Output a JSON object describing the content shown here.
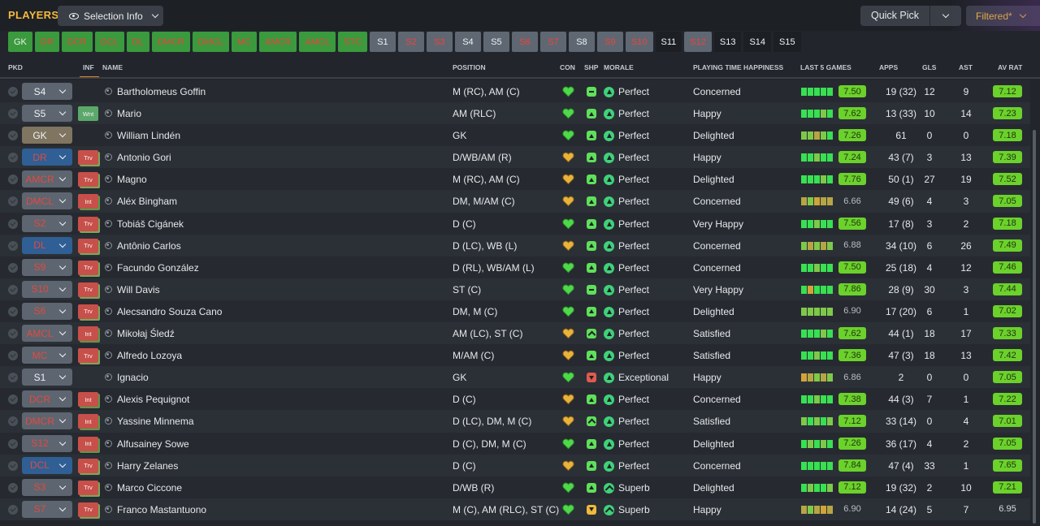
{
  "topbar": {
    "title": "PLAYERS",
    "selection_info": "Selection Info",
    "quick_pick": "Quick Pick",
    "filtered": "Filtered*"
  },
  "chips": [
    {
      "label": "GK",
      "style": "green"
    },
    {
      "label": "DR",
      "style": "green red-t"
    },
    {
      "label": "DCR",
      "style": "green red-t"
    },
    {
      "label": "DCL",
      "style": "green red-t"
    },
    {
      "label": "DL",
      "style": "green red-t"
    },
    {
      "label": "DMCR",
      "style": "green red-t"
    },
    {
      "label": "DMCL",
      "style": "green red-t"
    },
    {
      "label": "MC",
      "style": "green red-t"
    },
    {
      "label": "AMCR",
      "style": "green red-t"
    },
    {
      "label": "AMCL",
      "style": "green red-t"
    },
    {
      "label": "STC",
      "style": "green red-t"
    },
    {
      "label": "S1",
      "style": "grey"
    },
    {
      "label": "S2",
      "style": "grey red-t"
    },
    {
      "label": "S3",
      "style": "grey red-t"
    },
    {
      "label": "S4",
      "style": "grey"
    },
    {
      "label": "S5",
      "style": "grey"
    },
    {
      "label": "S6",
      "style": "grey red-t"
    },
    {
      "label": "S7",
      "style": "grey red-t"
    },
    {
      "label": "S8",
      "style": "grey"
    },
    {
      "label": "S9",
      "style": "grey red-t"
    },
    {
      "label": "S10",
      "style": "grey red-t"
    },
    {
      "label": "S11",
      "style": "dark"
    },
    {
      "label": "S12",
      "style": "grey red-t"
    },
    {
      "label": "S13",
      "style": "dark"
    },
    {
      "label": "S14",
      "style": "dark"
    },
    {
      "label": "S15",
      "style": "dark"
    }
  ],
  "columns": {
    "pkd": "PKD",
    "inf": "INF",
    "name": "NAME",
    "position": "POSITION",
    "con": "CON",
    "shp": "SHP",
    "morale": "MORALE",
    "pth": "PLAYING TIME HAPPINESS",
    "last5": "LAST 5 GAMES",
    "apps": "APPS",
    "gls": "GLS",
    "ast": "AST",
    "avrat": "AV RAT"
  },
  "colors": {
    "accent": "#f5b93d",
    "rating_green": "#6bd12b",
    "chip_green": "#3a9a3d"
  },
  "rows": [
    {
      "pos": "S4",
      "posStyle": "grey",
      "inf": "",
      "name": "Bartholomeus Goffin",
      "position": "M (RC), AM (C)",
      "con": "green",
      "shp": "flat",
      "shpColor": "shp-green",
      "morale": "Perfect",
      "moraleIcon": "up",
      "pth": "Concerned",
      "last5": [
        "g",
        "g",
        "g",
        "g",
        "g"
      ],
      "rating": "7.50",
      "ratingHi": true,
      "apps": "19 (32)",
      "gls": "12",
      "ast": "9",
      "avrat": "7.12",
      "avHi": true
    },
    {
      "pos": "S5",
      "posStyle": "grey",
      "inf": "Wnt",
      "name": "Mario",
      "position": "AM (RLC)",
      "con": "green",
      "shp": "up",
      "shpColor": "shp-green",
      "morale": "Perfect",
      "moraleIcon": "up",
      "pth": "Happy",
      "last5": [
        "g",
        "g",
        "g",
        "lg",
        "g"
      ],
      "rating": "7.62",
      "ratingHi": true,
      "apps": "13 (33)",
      "gls": "10",
      "ast": "14",
      "avrat": "7.23",
      "avHi": true
    },
    {
      "pos": "GK",
      "posStyle": "gk",
      "inf": "",
      "name": "William Lindén",
      "position": "GK",
      "con": "green",
      "shp": "up",
      "shpColor": "shp-green",
      "morale": "Perfect",
      "moraleIcon": "up",
      "pth": "Delighted",
      "last5": [
        "lg",
        "lg",
        "y",
        "lg",
        "g"
      ],
      "rating": "7.26",
      "ratingHi": true,
      "apps": "61",
      "gls": "0",
      "ast": "0",
      "avrat": "7.18",
      "avHi": true
    },
    {
      "pos": "DR",
      "posStyle": "blue",
      "inf": "Trv",
      "name": "Antonio Gori",
      "position": "D/WB/AM (R)",
      "con": "yellow",
      "shp": "up",
      "shpColor": "shp-green",
      "morale": "Perfect",
      "moraleIcon": "up",
      "pth": "Happy",
      "last5": [
        "g",
        "g",
        "lg",
        "g",
        "g"
      ],
      "rating": "7.24",
      "ratingHi": true,
      "apps": "43 (7)",
      "gls": "3",
      "ast": "13",
      "avrat": "7.39",
      "avHi": true
    },
    {
      "pos": "AMCR",
      "posStyle": "grey-red",
      "inf": "Trv",
      "name": "Magno",
      "position": "M (RC), AM (C)",
      "con": "yellow",
      "shp": "up",
      "shpColor": "shp-green",
      "morale": "Perfect",
      "moraleIcon": "up",
      "pth": "Delighted",
      "last5": [
        "g",
        "g",
        "g",
        "lg",
        "g"
      ],
      "rating": "7.76",
      "ratingHi": true,
      "apps": "50 (1)",
      "gls": "27",
      "ast": "19",
      "avrat": "7.52",
      "avHi": true
    },
    {
      "pos": "DMCL",
      "posStyle": "grey-red",
      "inf": "Int",
      "name": "Aléx Bingham",
      "position": "DM, M/AM (C)",
      "con": "yellow",
      "shp": "up",
      "shpColor": "shp-green",
      "morale": "Perfect",
      "moraleIcon": "up",
      "pth": "Concerned",
      "last5": [
        "y",
        "lg",
        "o",
        "y",
        "y"
      ],
      "rating": "6.66",
      "ratingHi": false,
      "apps": "49 (6)",
      "gls": "4",
      "ast": "3",
      "avrat": "7.05",
      "avHi": true
    },
    {
      "pos": "S2",
      "posStyle": "grey-red",
      "inf": "Trv",
      "name": "Tobiáš Cigánek",
      "position": "D (C)",
      "con": "green",
      "shp": "up",
      "shpColor": "shp-green",
      "morale": "Perfect",
      "moraleIcon": "up",
      "pth": "Very Happy",
      "last5": [
        "g",
        "g",
        "lg",
        "g",
        "g"
      ],
      "rating": "7.56",
      "ratingHi": true,
      "apps": "17 (8)",
      "gls": "3",
      "ast": "2",
      "avrat": "7.18",
      "avHi": true
    },
    {
      "pos": "DL",
      "posStyle": "blue",
      "inf": "Trv",
      "name": "Antônio Carlos",
      "position": "D (LC), WB (L)",
      "con": "yellow",
      "shp": "up",
      "shpColor": "shp-green",
      "morale": "Perfect",
      "moraleIcon": "up",
      "pth": "Concerned",
      "last5": [
        "lg",
        "y",
        "lg",
        "y",
        "lg"
      ],
      "rating": "6.88",
      "ratingHi": false,
      "apps": "34 (10)",
      "gls": "6",
      "ast": "26",
      "avrat": "7.49",
      "avHi": true
    },
    {
      "pos": "S9",
      "posStyle": "grey-red",
      "inf": "Trv",
      "name": "Facundo González",
      "position": "D (RL), WB/AM (L)",
      "con": "green",
      "shp": "up",
      "shpColor": "shp-green",
      "morale": "Perfect",
      "moraleIcon": "up",
      "pth": "Concerned",
      "last5": [
        "g",
        "g",
        "lg",
        "g",
        "g"
      ],
      "rating": "7.50",
      "ratingHi": true,
      "apps": "25 (18)",
      "gls": "4",
      "ast": "12",
      "avrat": "7.46",
      "avHi": true
    },
    {
      "pos": "S10",
      "posStyle": "grey-red",
      "inf": "Trv",
      "name": "Will Davis",
      "position": "ST (C)",
      "con": "green",
      "shp": "flat",
      "shpColor": "shp-green",
      "morale": "Perfect",
      "moraleIcon": "up",
      "pth": "Very Happy",
      "last5": [
        "g",
        "o",
        "g",
        "g",
        "g"
      ],
      "rating": "7.86",
      "ratingHi": true,
      "apps": "28 (9)",
      "gls": "30",
      "ast": "3",
      "avrat": "7.44",
      "avHi": true
    },
    {
      "pos": "S6",
      "posStyle": "grey-red",
      "inf": "Trv",
      "name": "Alecsandro Souza Cano",
      "position": "DM, M (C)",
      "con": "green",
      "shp": "up",
      "shpColor": "shp-green",
      "morale": "Perfect",
      "moraleIcon": "up",
      "pth": "Delighted",
      "last5": [
        "lg",
        "lg",
        "lg",
        "lg",
        "lg"
      ],
      "rating": "6.90",
      "ratingHi": false,
      "apps": "17 (20)",
      "gls": "6",
      "ast": "1",
      "avrat": "7.02",
      "avHi": true
    },
    {
      "pos": "AMCL",
      "posStyle": "grey-red",
      "inf": "Int",
      "name": "Mikołaj Śledź",
      "position": "AM (LC), ST (C)",
      "con": "yellow",
      "shp": "up2",
      "shpColor": "shp-green",
      "morale": "Perfect",
      "moraleIcon": "up",
      "pth": "Satisfied",
      "last5": [
        "g",
        "g",
        "g",
        "lg",
        "g"
      ],
      "rating": "7.62",
      "ratingHi": true,
      "apps": "44 (1)",
      "gls": "18",
      "ast": "17",
      "avrat": "7.33",
      "avHi": true
    },
    {
      "pos": "MC",
      "posStyle": "grey-red",
      "inf": "Trv",
      "name": "Alfredo Lozoya",
      "position": "M/AM (C)",
      "con": "yellow",
      "shp": "up",
      "shpColor": "shp-green",
      "morale": "Perfect",
      "moraleIcon": "up",
      "pth": "Satisfied",
      "last5": [
        "g",
        "g",
        "lg",
        "g",
        "g"
      ],
      "rating": "7.36",
      "ratingHi": true,
      "apps": "47 (3)",
      "gls": "18",
      "ast": "13",
      "avrat": "7.42",
      "avHi": true
    },
    {
      "pos": "S1",
      "posStyle": "grey",
      "inf": "",
      "name": "Ignacio",
      "position": "GK",
      "con": "green",
      "shp": "down",
      "shpColor": "shp-red",
      "morale": "Exceptional",
      "moraleIcon": "up",
      "pth": "Happy",
      "last5": [
        "o",
        "y",
        "lg",
        "y",
        "lg"
      ],
      "rating": "6.86",
      "ratingHi": false,
      "apps": "2",
      "gls": "0",
      "ast": "0",
      "avrat": "7.05",
      "avHi": true
    },
    {
      "pos": "DCR",
      "posStyle": "grey-red",
      "inf": "Int",
      "name": "Alexis Pequignot",
      "position": "D (C)",
      "con": "yellow",
      "shp": "up",
      "shpColor": "shp-green",
      "morale": "Perfect",
      "moraleIcon": "up",
      "pth": "Concerned",
      "last5": [
        "g",
        "g",
        "lg",
        "g",
        "g"
      ],
      "rating": "7.38",
      "ratingHi": true,
      "apps": "44 (3)",
      "gls": "7",
      "ast": "1",
      "avrat": "7.22",
      "avHi": true
    },
    {
      "pos": "DMCR",
      "posStyle": "grey-red",
      "inf": "Int",
      "name": "Yassine Minnema",
      "position": "D (LC), DM, M (C)",
      "con": "yellow",
      "shp": "up2",
      "shpColor": "shp-green",
      "morale": "Perfect",
      "moraleIcon": "up",
      "pth": "Satisfied",
      "last5": [
        "lg",
        "g",
        "lg",
        "g",
        "lg"
      ],
      "rating": "7.12",
      "ratingHi": true,
      "apps": "33 (14)",
      "gls": "0",
      "ast": "4",
      "avrat": "7.01",
      "avHi": true
    },
    {
      "pos": "S12",
      "posStyle": "grey-red",
      "inf": "Int",
      "name": "Alfusainey Sowe",
      "position": "D (C), DM, M (C)",
      "con": "green",
      "shp": "up",
      "shpColor": "shp-green",
      "morale": "Perfect",
      "moraleIcon": "up",
      "pth": "Delighted",
      "last5": [
        "g",
        "lg",
        "g",
        "lg",
        "g"
      ],
      "rating": "7.26",
      "ratingHi": true,
      "apps": "36 (17)",
      "gls": "4",
      "ast": "2",
      "avrat": "7.05",
      "avHi": true
    },
    {
      "pos": "DCL",
      "posStyle": "blue",
      "inf": "Trv",
      "name": "Harry Zelanes",
      "position": "D (C)",
      "con": "yellow",
      "shp": "up",
      "shpColor": "shp-green",
      "morale": "Perfect",
      "moraleIcon": "up",
      "pth": "Concerned",
      "last5": [
        "g",
        "g",
        "g",
        "g",
        "g"
      ],
      "rating": "7.84",
      "ratingHi": true,
      "apps": "47 (4)",
      "gls": "33",
      "ast": "1",
      "avrat": "7.65",
      "avHi": true
    },
    {
      "pos": "S3",
      "posStyle": "grey-red",
      "inf": "Trv",
      "name": "Marco Ciccone",
      "position": "D/WB (R)",
      "con": "green",
      "shp": "up",
      "shpColor": "shp-green",
      "morale": "Superb",
      "moraleIcon": "superb",
      "pth": "Delighted",
      "last5": [
        "g",
        "lg",
        "g",
        "g",
        "lg"
      ],
      "rating": "7.12",
      "ratingHi": true,
      "apps": "19 (32)",
      "gls": "2",
      "ast": "10",
      "avrat": "7.21",
      "avHi": true
    },
    {
      "pos": "S7",
      "posStyle": "grey-red",
      "inf": "Trv",
      "name": "Franco Mastantuono",
      "position": "M (C), AM (RLC), ST (C)",
      "con": "green",
      "shp": "down",
      "shpColor": "shp-yellow",
      "morale": "Superb",
      "moraleIcon": "superb",
      "pth": "Happy",
      "last5": [
        "y",
        "lg",
        "y",
        "o",
        "y"
      ],
      "rating": "6.90",
      "ratingHi": false,
      "apps": "14 (24)",
      "gls": "5",
      "ast": "7",
      "avrat": "6.95",
      "avHi": false
    }
  ]
}
